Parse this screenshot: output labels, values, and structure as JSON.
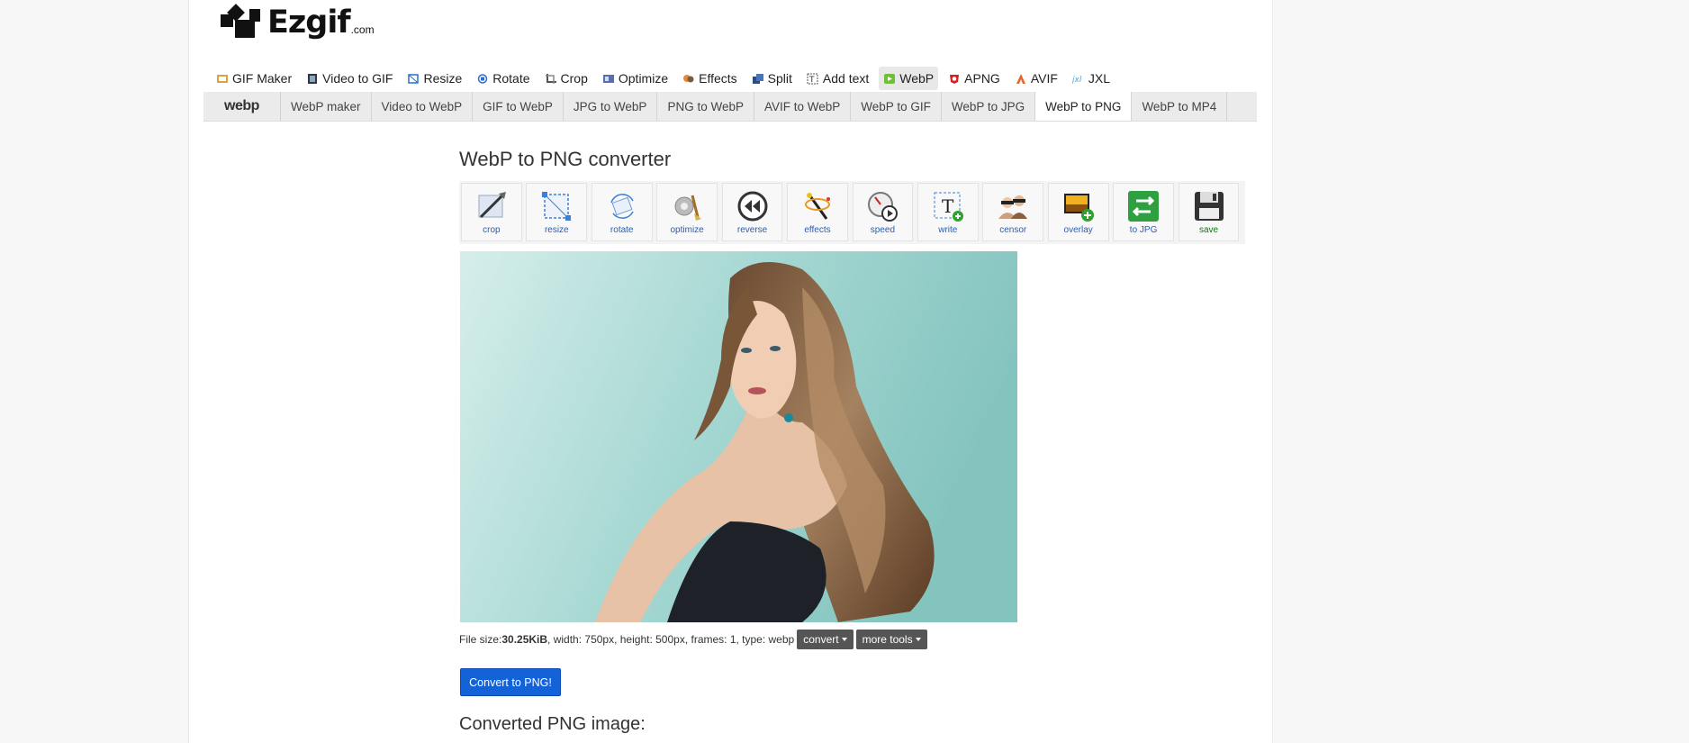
{
  "logo": {
    "name": "Ezgif",
    "suffix": ".com"
  },
  "top_nav": [
    {
      "label": "GIF Maker",
      "icon": "gif-maker-icon",
      "active": false
    },
    {
      "label": "Video to GIF",
      "icon": "video-icon",
      "active": false
    },
    {
      "label": "Resize",
      "icon": "resize-icon",
      "active": false
    },
    {
      "label": "Rotate",
      "icon": "rotate-icon",
      "active": false
    },
    {
      "label": "Crop",
      "icon": "crop-icon",
      "active": false
    },
    {
      "label": "Optimize",
      "icon": "optimize-icon",
      "active": false
    },
    {
      "label": "Effects",
      "icon": "effects-icon",
      "active": false
    },
    {
      "label": "Split",
      "icon": "split-icon",
      "active": false
    },
    {
      "label": "Add text",
      "icon": "add-text-icon",
      "active": false
    },
    {
      "label": "WebP",
      "icon": "webp-icon",
      "active": true
    },
    {
      "label": "APNG",
      "icon": "apng-icon",
      "active": false
    },
    {
      "label": "AVIF",
      "icon": "avif-icon",
      "active": false
    },
    {
      "label": "JXL",
      "icon": "jxl-icon",
      "active": false
    }
  ],
  "sub_nav": {
    "brand": "webp",
    "tabs": [
      {
        "label": "WebP maker",
        "active": false
      },
      {
        "label": "Video to WebP",
        "active": false
      },
      {
        "label": "GIF to WebP",
        "active": false
      },
      {
        "label": "JPG to WebP",
        "active": false
      },
      {
        "label": "PNG to WebP",
        "active": false
      },
      {
        "label": "AVIF to WebP",
        "active": false
      },
      {
        "label": "WebP to GIF",
        "active": false
      },
      {
        "label": "WebP to JPG",
        "active": false
      },
      {
        "label": "WebP to PNG",
        "active": true
      },
      {
        "label": "WebP to MP4",
        "active": false
      }
    ]
  },
  "page_title": "WebP to PNG converter",
  "tools": [
    {
      "label": "crop",
      "icon": "crop-tool-icon"
    },
    {
      "label": "resize",
      "icon": "resize-tool-icon"
    },
    {
      "label": "rotate",
      "icon": "rotate-tool-icon"
    },
    {
      "label": "optimize",
      "icon": "optimize-tool-icon"
    },
    {
      "label": "reverse",
      "icon": "reverse-tool-icon"
    },
    {
      "label": "effects",
      "icon": "effects-tool-icon"
    },
    {
      "label": "speed",
      "icon": "speed-tool-icon"
    },
    {
      "label": "write",
      "icon": "write-tool-icon"
    },
    {
      "label": "censor",
      "icon": "censor-tool-icon"
    },
    {
      "label": "overlay",
      "icon": "overlay-tool-icon"
    },
    {
      "label": "to JPG",
      "icon": "to-jpg-tool-icon"
    },
    {
      "label": "save",
      "icon": "save-tool-icon"
    }
  ],
  "file_info": {
    "prefix": "File size: ",
    "size": "30.25KiB",
    "rest": ", width: 750px, height: 500px, frames: 1, type: webp"
  },
  "convert_dropdown": "convert",
  "more_tools_dropdown": "more tools",
  "convert_button": "Convert to PNG!",
  "result_heading": "Converted PNG image:",
  "colors": {
    "primary_button": "#1462d8",
    "dropdown": "#555555",
    "active_tab": "#ffffff"
  }
}
